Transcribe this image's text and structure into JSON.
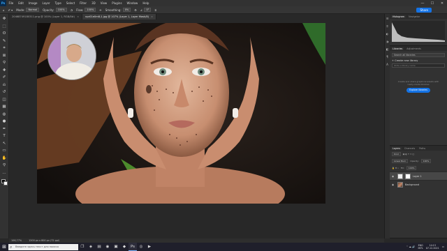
{
  "app": {
    "logo": "Ps"
  },
  "menu": [
    "File",
    "Edit",
    "Image",
    "Layer",
    "Type",
    "Select",
    "Filter",
    "3D",
    "View",
    "Plugins",
    "Window",
    "Help"
  ],
  "window_controls": {
    "minimize": "—",
    "maximize": "☐",
    "close": "✕"
  },
  "options_bar": {
    "mode_label": "Mode:",
    "mode_value": "Normal",
    "opacity_label": "Opacity:",
    "opacity_value": "100%",
    "flow_label": "Flow:",
    "flow_value": "100%",
    "smoothing_label": "Smoothing:",
    "smoothing_value": "0%",
    "angle_value": "0°",
    "share_label": "Share"
  },
  "tabs": [
    {
      "label": "20468749180311.png @ 100% (Layer 1, RGB/8#)",
      "close": "×",
      "active": false
    },
    {
      "label": "npr01e0m8-1.jpg @ 107% (Layer 1, Layer Mask/8)",
      "close": "×",
      "active": true
    }
  ],
  "tools": [
    "move-icon",
    "marquee-icon",
    "lasso-icon",
    "quick-select-icon",
    "crop-icon",
    "frame-icon",
    "eyedropper-icon",
    "healing-icon",
    "brush-icon",
    "clone-stamp-icon",
    "history-brush-icon",
    "eraser-icon",
    "gradient-icon",
    "blur-icon",
    "dodge-icon",
    "pen-icon",
    "type-icon",
    "path-select-icon",
    "rectangle-icon",
    "hand-icon",
    "zoom-icon",
    "more-tools-icon"
  ],
  "tool_glyphs": [
    "✥",
    "⬚",
    "ʘ",
    "✎",
    "⌗",
    "⊠",
    "⚲",
    "✚",
    "✐",
    "⎌",
    "↺",
    "◫",
    "▦",
    "◍",
    "●",
    "✒",
    "T",
    "↖",
    "▭",
    "✋",
    "⚲",
    "…"
  ],
  "status": {
    "zoom": "106,77%",
    "doc": "1200 px x 800 px (72 ppi)"
  },
  "side_icons": [
    "☰",
    "⌗",
    "◐",
    "◑",
    "◧",
    "¶",
    "A"
  ],
  "histogram_panel": {
    "tabs": [
      "Histogram",
      "Navigator"
    ]
  },
  "libraries_panel": {
    "tabs": [
      "Libraries",
      "Adjustments"
    ],
    "search_placeholder": "Search all libraries",
    "create_label": "+ Create new library",
    "name_placeholder": "Write a library name",
    "description": "Create and share graphical assets with ready-made libraries",
    "explore_label": "Explore libraries"
  },
  "layers_panel": {
    "tabs": [
      "Layers",
      "Channels",
      "Paths"
    ],
    "kind_label": "Kind",
    "blend_mode": "Linear Burn",
    "opacity_label": "Opacity:",
    "opacity_value": "100%",
    "fill_label": "Fill:",
    "fill_value": "100%",
    "layers": [
      {
        "name": "Layer 1",
        "selected": true
      },
      {
        "name": "Background",
        "selected": false
      }
    ]
  },
  "taskbar": {
    "start": "⊞",
    "search_placeholder": "Введите здесь текст для поиска",
    "apps": [
      "❐",
      "◈",
      "▤",
      "◉",
      "▣",
      "◆",
      "Ps",
      "◎",
      "▶"
    ],
    "lang": "ENG",
    "lang2": "INTL",
    "time": "14:13",
    "date": "07.12.2021"
  },
  "colors": {
    "accent": "#1473e6",
    "panel": "#323232",
    "workspace": "#282828"
  }
}
